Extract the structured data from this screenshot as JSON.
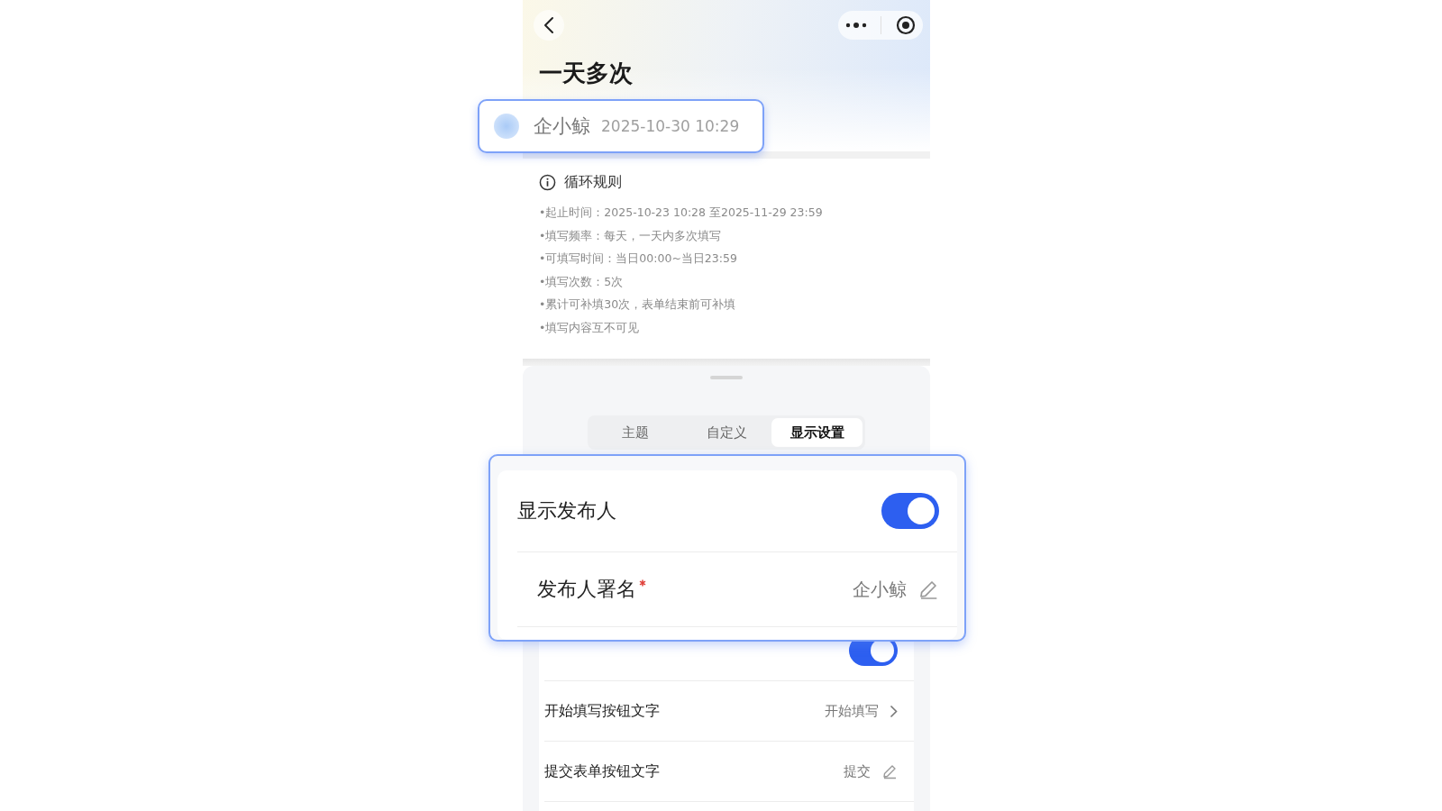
{
  "header": {
    "title": "一天多次"
  },
  "publisher_callout": {
    "name": "企小鲸",
    "time": "2025-10-30 10:29"
  },
  "rules": {
    "title": "循环规则",
    "items": [
      "•起止时间：2025-10-23 10:28 至2025-11-29 23:59",
      "•填写频率：每天，一天内多次填写",
      "•可填写时间：当日00:00~当日23:59",
      "•填写次数：5次",
      "•累计可补填30次，表单结束前可补填",
      "•填写内容互不可见"
    ]
  },
  "tabs": [
    {
      "label": "主题",
      "selected": false
    },
    {
      "label": "自定义",
      "selected": false
    },
    {
      "label": "显示设置",
      "selected": true
    }
  ],
  "settings_callout": [
    {
      "kind": "toggle",
      "label": "显示发布人",
      "on": true
    },
    {
      "kind": "edit",
      "label": "发布人署名",
      "required": true,
      "value": "企小鲸"
    }
  ],
  "settings": [
    {
      "kind": "toggle",
      "on": true
    },
    {
      "kind": "link",
      "label": "开始填写按钮文字",
      "value": "开始填写"
    },
    {
      "kind": "edit",
      "label": "提交表单按钮文字",
      "value": "提交"
    }
  ]
}
